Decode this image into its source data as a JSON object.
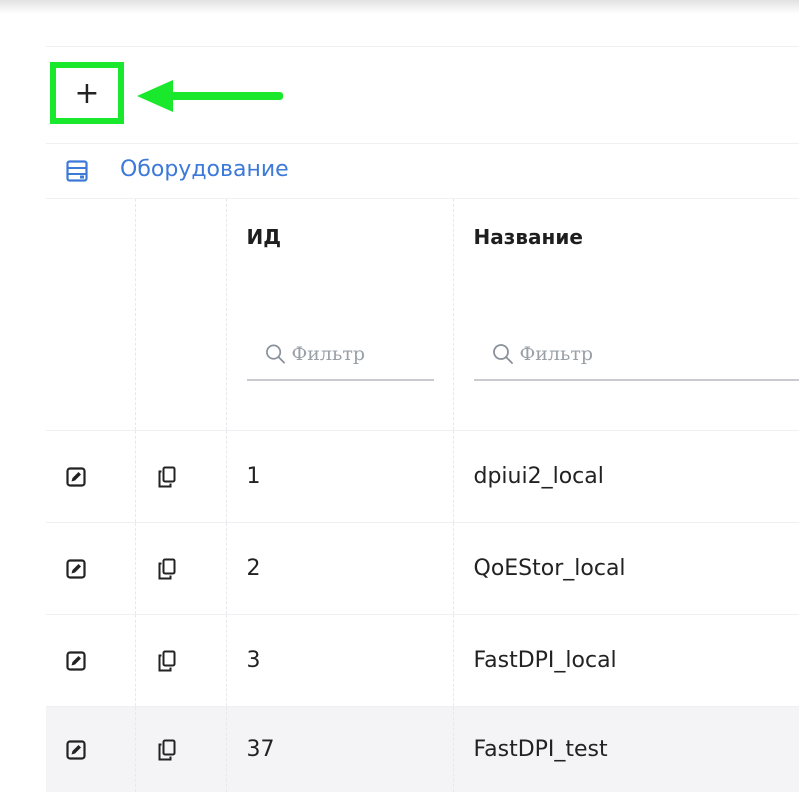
{
  "toolbar": {
    "add_label": "+"
  },
  "section": {
    "title": "Оборудование",
    "icon": "server-icon",
    "accent_color": "#3c79d8"
  },
  "highlight_color": "#19e82c",
  "table": {
    "columns": [
      {
        "label": "ИД",
        "filter_placeholder": "Фильтр"
      },
      {
        "label": "Название",
        "filter_placeholder": "Фильтр"
      }
    ],
    "rows": [
      {
        "id": "1",
        "name": "dpiui2_local"
      },
      {
        "id": "2",
        "name": "QoEStor_local"
      },
      {
        "id": "3",
        "name": "FastDPI_local"
      },
      {
        "id": "37",
        "name": "FastDPI_test"
      }
    ]
  }
}
